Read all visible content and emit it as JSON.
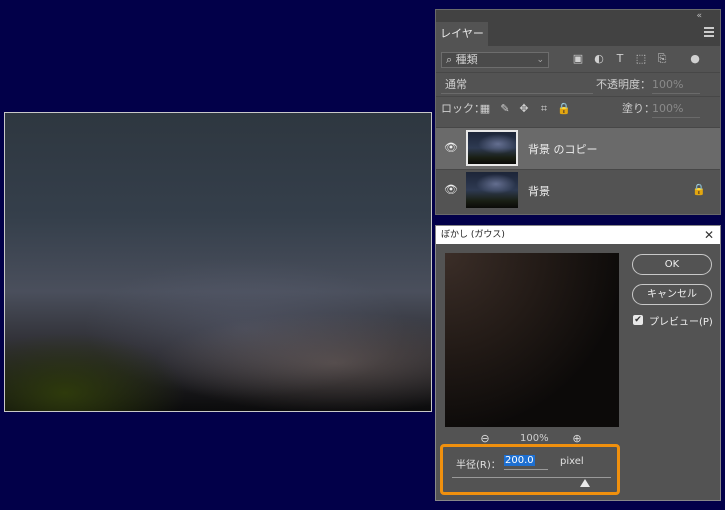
{
  "layers_panel": {
    "collapse_icon": "«",
    "tab_label": "レイヤー",
    "filter_kind": "種類",
    "blend_mode": "通常",
    "opacity_label": "不透明度：",
    "opacity_value": "100%",
    "lock_label": "ロック：",
    "fill_label": "塗り：",
    "fill_value": "100%",
    "layers": [
      {
        "name": "背景 のコピー",
        "selected": true,
        "locked": false
      },
      {
        "name": "背景",
        "selected": false,
        "locked": true
      }
    ]
  },
  "blur_dialog": {
    "title": "ぼかし (ガウス)",
    "close_glyph": "✕",
    "ok_label": "OK",
    "cancel_label": "キャンセル",
    "preview_label": "プレビュー(P)",
    "preview_checked": true,
    "zoom_level": "100%",
    "radius_label": "半径(R)：",
    "radius_value": "200.0",
    "radius_unit": "pixel",
    "highlight_color": "#f0900e"
  }
}
